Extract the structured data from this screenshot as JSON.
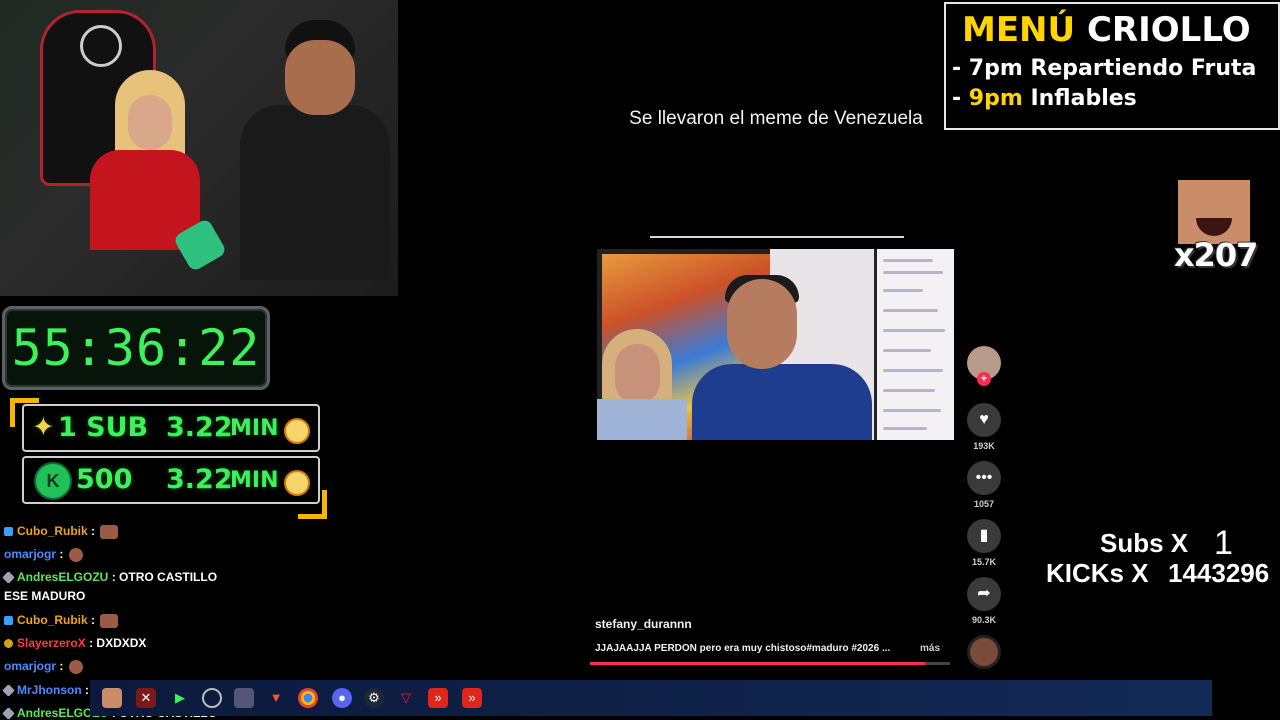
{
  "timer": {
    "value": "55:36:22"
  },
  "rates": [
    {
      "label": "1 SUB",
      "time": "3.22",
      "unit": "MIN",
      "prefix_icon": "sparkle-icon"
    },
    {
      "label": "500",
      "time": "3.22",
      "unit": "MIN",
      "prefix_icon": "kick-gem-icon"
    }
  ],
  "chat": [
    {
      "user": "Cubo_Rubik",
      "color": "#f0a020",
      "sep": ":",
      "msg": ""
    },
    {
      "user": "omarjogr",
      "color": "#4a8cff",
      "sep": ":",
      "msg": ""
    },
    {
      "user": "AndresELGOZU",
      "color": "#5ce65c",
      "sep": ":",
      "msg": "OTRO CASTILLO"
    },
    {
      "user": "",
      "color": "#ffffff",
      "sep": "",
      "msg": "ESE MADURO"
    },
    {
      "user": "Cubo_Rubik",
      "color": "#f0a020",
      "sep": ":",
      "msg": ""
    },
    {
      "user": "SlayerzeroX",
      "color": "#ff3b3b",
      "sep": ":",
      "msg": "DXDXDX"
    },
    {
      "user": "omarjogr",
      "color": "#4a8cff",
      "sep": ":",
      "msg": ""
    },
    {
      "user": "MrJhonson",
      "color": "#4a8cff",
      "sep": ":",
      "msg": ""
    },
    {
      "user": "AndresELGOZU",
      "color": "#5ce65c",
      "sep": ":",
      "msg": "OTRO CASTILLO"
    }
  ],
  "menu": {
    "title_a": "MENÚ",
    "title_b": "CRIOLLO",
    "line1": "- 7pm Repartiendo Fruta",
    "line2_dash": "- ",
    "line2_time": "9pm",
    "line2_rest": "Inflables"
  },
  "video": {
    "caption": "Se llevaron el meme de Venezuela",
    "author": "stefany_durannn",
    "description": "JJAJAAJJA PERDON pero era muy chistoso#maduro #2026 ...",
    "more": "más",
    "progress": 0.93,
    "likes": "193K",
    "comments": "1057",
    "saves": "15.7K",
    "shares": "90.3K"
  },
  "emote_counter": {
    "count": "x207"
  },
  "counters": {
    "subs_label": "Subs X",
    "subs_value": "1",
    "kicks_label": "KICKs X",
    "kicks_value": "1443296"
  },
  "colors": {
    "timer_green": "#3cf25a",
    "menu_yellow": "#ffd400",
    "tiktok_red": "#fe2c55"
  }
}
